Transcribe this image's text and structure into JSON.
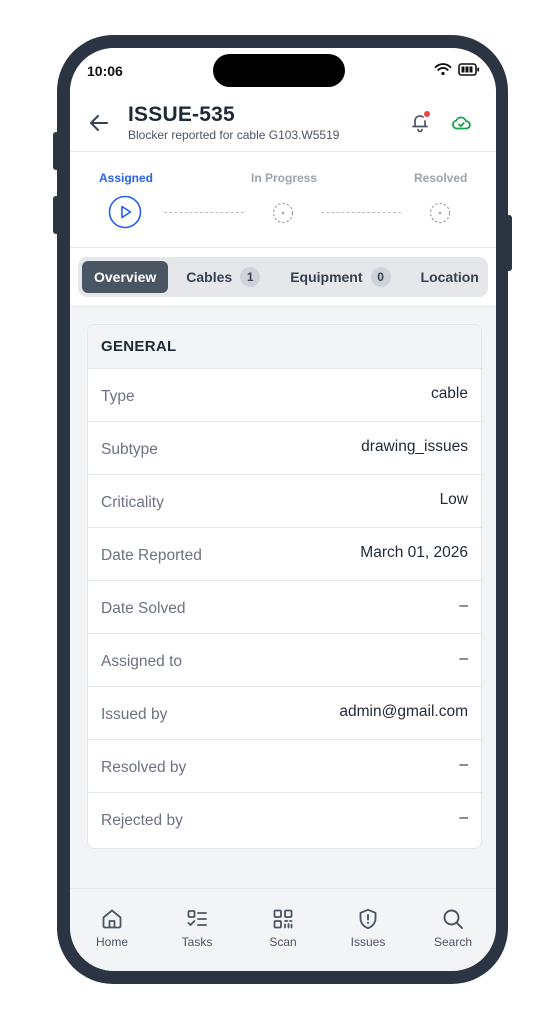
{
  "status_bar": {
    "time": "10:06"
  },
  "header": {
    "title": "ISSUE-535",
    "subtitle": "Blocker reported for cable G103.W5519"
  },
  "stepper": {
    "steps": [
      {
        "label": "Assigned",
        "state": "active"
      },
      {
        "label": "In Progress",
        "state": "pending"
      },
      {
        "label": "Resolved",
        "state": "pending"
      }
    ]
  },
  "tabs": [
    {
      "label": "Overview",
      "active": true
    },
    {
      "label": "Cables",
      "count": "1"
    },
    {
      "label": "Equipment",
      "count": "0"
    },
    {
      "label": "Location"
    }
  ],
  "general": {
    "heading": "GENERAL",
    "rows": [
      {
        "label": "Type",
        "value": "cable"
      },
      {
        "label": "Subtype",
        "value": "drawing_issues"
      },
      {
        "label": "Criticality",
        "value": "Low"
      },
      {
        "label": "Date Reported",
        "value": "March 01, 2026"
      },
      {
        "label": "Date Solved",
        "value": "–"
      },
      {
        "label": "Assigned to",
        "value": "–"
      },
      {
        "label": "Issued by",
        "value": "admin@gmail.com"
      },
      {
        "label": "Resolved by",
        "value": "–"
      },
      {
        "label": "Rejected by",
        "value": "–"
      }
    ]
  },
  "bottom_nav": [
    {
      "label": "Home",
      "icon": "home-icon"
    },
    {
      "label": "Tasks",
      "icon": "tasks-icon"
    },
    {
      "label": "Scan",
      "icon": "qr-scan-icon"
    },
    {
      "label": "Issues",
      "icon": "shield-alert-icon"
    },
    {
      "label": "Search",
      "icon": "search-icon"
    }
  ],
  "colors": {
    "accent": "#2563eb",
    "notification_dot": "#ef4444",
    "sync_icon": "#16a34a",
    "frame": "#2b3442"
  }
}
